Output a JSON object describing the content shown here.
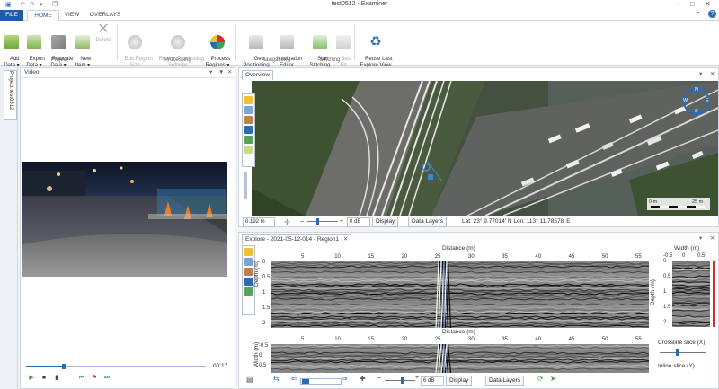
{
  "window": {
    "title": "test0512 - Examiner",
    "help_label": "?"
  },
  "tabs": [
    {
      "label": "FILE"
    },
    {
      "label": "HOME"
    },
    {
      "label": "VIEW"
    },
    {
      "label": "OVERLAYS"
    }
  ],
  "ribbon": {
    "add_data": "Add\nData ▾",
    "export_data": "Export\nData ▾",
    "relocate_data": "Relocate\nData ▾",
    "new_item": "New\nItem ▾",
    "delete": "Delete",
    "edit_region_size": "Edit Region\nSize",
    "region_processing_settings": "Region Processing\nSettings",
    "process_regions": "Process\nRegions ▾",
    "geo_positioning": "Geo\nPositioning",
    "navigation_editor": "Navigation\nEditor",
    "start_stitching": "Start\nStitching",
    "best_fit": "Best\nFit",
    "reuse_last_explore_view": "Reuse Last\nExplore View",
    "group_project": "Project",
    "group_processing": "Processing",
    "group_navigation": "Navigation",
    "group_stitching": "Stitching"
  },
  "side_tab": {
    "label": "Project test0512"
  },
  "video": {
    "title": "Video",
    "time": "00:17",
    "progress_fraction": 0.21
  },
  "overview": {
    "tab_label": "Overview",
    "scale_field": "0.192 m",
    "db_field": "0 dB",
    "display_button": "Display",
    "data_layers_button": "Data Layers",
    "coordinates": "Lat: 23° 9.77014' N Lon: 113° 11.78578' E",
    "map_scale_label": "25 m",
    "map_scale_zero": "0 m",
    "compass_labels": {
      "n": "N",
      "e": "E",
      "s": "S",
      "w": "W"
    }
  },
  "explore": {
    "tab_label": "Explore - 2021-05-12-014 - Region1",
    "top_xlabel": "Distance (m)",
    "top_ylabel": "Depth (m)",
    "x_ticks": [
      "5",
      "10",
      "15",
      "20",
      "25",
      "30",
      "35",
      "40",
      "45",
      "50",
      "55"
    ],
    "depth_ticks": [
      "0",
      "0.5",
      "1",
      "1.5",
      "2"
    ],
    "bottom_xlabel": "Distance (m)",
    "bottom_ylabel": "Width (m)",
    "width_ticks": [
      "-0.5",
      "0",
      "0.5"
    ],
    "slice_xlabel": "Width (m)",
    "slice_ylabel": "Depth (m)",
    "slice_x_ticks": [
      "-0.5",
      "0",
      "0.5"
    ],
    "slice_depth_ticks": [
      "0",
      "0.5",
      "1",
      "1.5",
      "2"
    ],
    "crossline_label": "Crossline slice (X)",
    "inline_label": "Inline slice (Y)",
    "db_field": "6 dB",
    "display_button": "Display",
    "data_layers_button": "Data Layers"
  },
  "colors": {
    "file_tab": "#1e5ba8",
    "accent": "#2b6cb0",
    "marker_red": "#d0312d"
  }
}
